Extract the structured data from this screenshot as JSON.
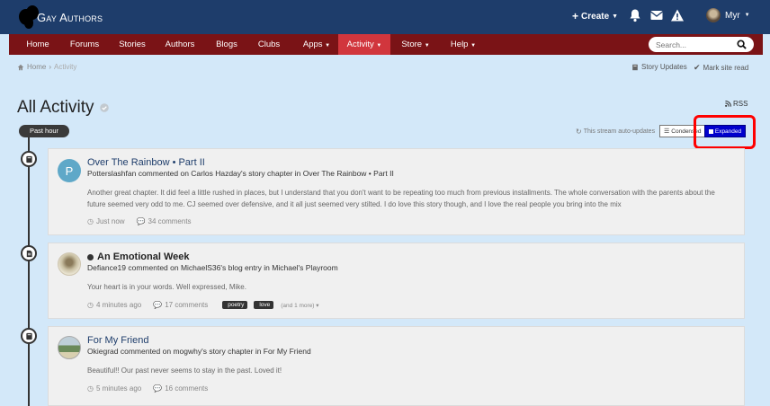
{
  "header": {
    "logo_text": "Gay Authors",
    "create_label": "Create",
    "user_name": "Myr"
  },
  "nav": {
    "items": [
      "Home",
      "Forums",
      "Stories",
      "Authors",
      "Blogs",
      "Clubs",
      "Apps",
      "Activity",
      "Store",
      "Help"
    ],
    "active": "Activity",
    "search_placeholder": "Search..."
  },
  "breadcrumb": {
    "home": "Home",
    "current": "Activity"
  },
  "actions": {
    "story_updates": "Story Updates",
    "mark_read": "Mark site read"
  },
  "page": {
    "title": "All Activity",
    "rss": "RSS",
    "time_pill": "Past hour",
    "auto_updates": "This stream auto-updates",
    "view_condensed": "Condensed",
    "view_expanded": "Expanded"
  },
  "colors": {
    "header_bg": "#1e3d6b",
    "nav_bg": "#7a1316",
    "nav_active": "#d1363d",
    "page_bg": "#d3e8f9",
    "highlight": "#ff0000",
    "expanded_bg": "#0000cc"
  },
  "activities": [
    {
      "icon": "book-icon",
      "avatar_letter": "P",
      "title": "Over The Rainbow • Part II",
      "subtitle": "Potterslashfan commented on Carlos Hazday's story chapter in Over The Rainbow • Part II",
      "body": "Another great chapter. It did feel a little rushed in places, but I understand that you don't want to be repeating too much from previous installments. The whole conversation with the parents about the future seemed very odd to me. CJ seemed over defensive, and it all just seemed very stilted. I do love this story though, and I love the real people you bring into the mix",
      "time": "Just now",
      "comments": "34 comments"
    },
    {
      "icon": "blog-icon",
      "title": "An Emotional Week",
      "subtitle": "Defiance19 commented on MichaelS36's blog entry in Michael's Playroom",
      "body": "Your heart is in your words. Well expressed, Mike.",
      "time": "4 minutes ago",
      "comments": "17 comments",
      "tags": [
        "poetry",
        "love"
      ],
      "more": "(and 1 more)"
    },
    {
      "icon": "book-icon",
      "title": "For My Friend",
      "subtitle": "Okiegrad commented on mogwhy's story chapter in For My Friend",
      "body": "Beautiful!! Our past never seems to stay in the past. Loved it!",
      "time": "5 minutes ago",
      "comments": "16 comments"
    }
  ]
}
